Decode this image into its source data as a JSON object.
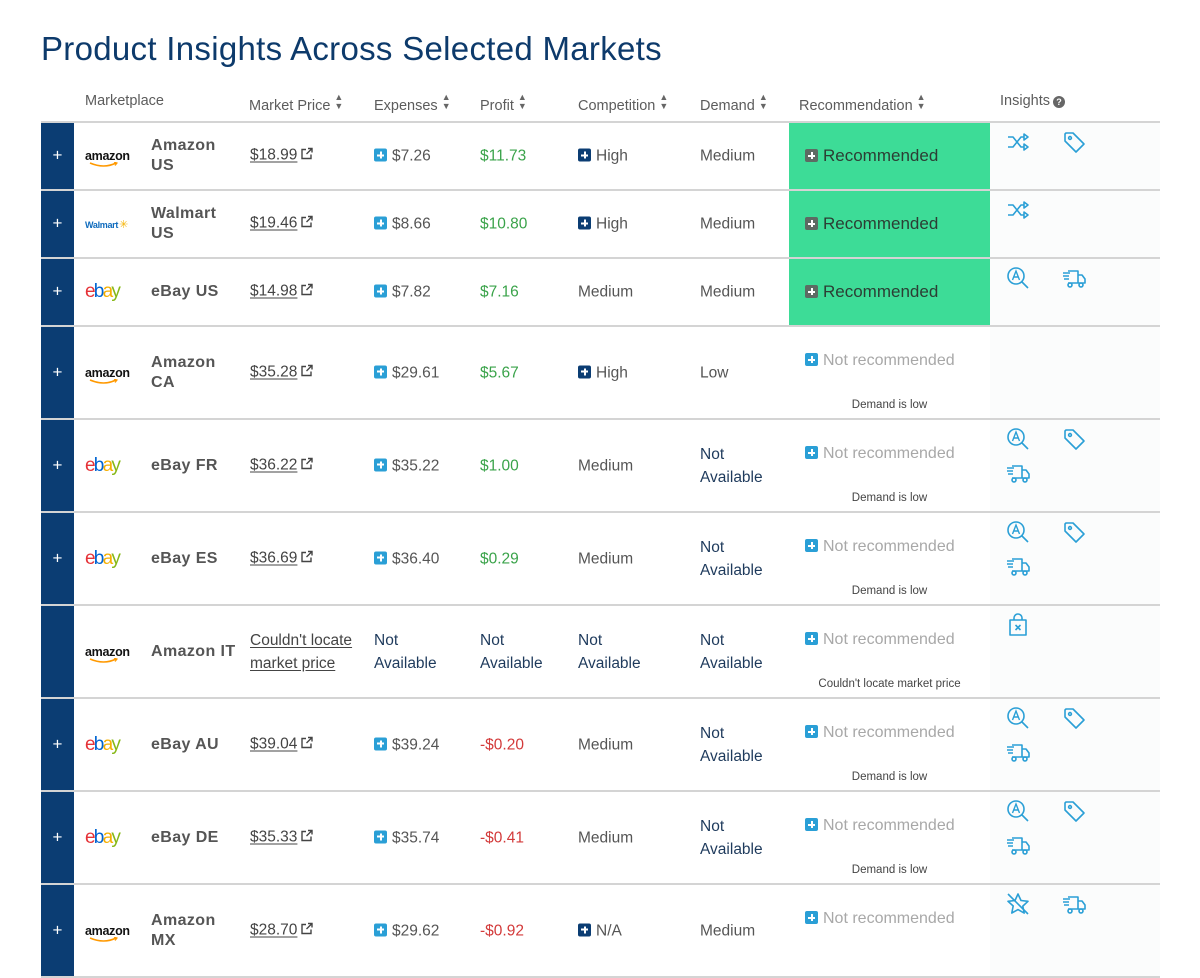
{
  "page": {
    "title": "Product Insights Across Selected Markets"
  },
  "colors": {
    "navy": "#0b3d73",
    "recommended_green": "#3ddc97",
    "profit_positive": "#3aa34a",
    "profit_negative": "#d33a3a",
    "icon_blue": "#2a9fd6"
  },
  "columns": {
    "marketplace": "Marketplace",
    "market_price": "Market Price",
    "expenses": "Expenses",
    "profit": "Profit",
    "competition": "Competition",
    "demand": "Demand",
    "recommendation": "Recommendation",
    "insights": "Insights"
  },
  "rows": [
    {
      "logo": "amazon",
      "name": "Amazon US",
      "price": "$18.99",
      "expenses": "$7.26",
      "profit": "$11.73",
      "profit_sign": "pos",
      "competition": "High",
      "demand": "Medium",
      "recommendation": "Recommended",
      "reason": "",
      "insights": [
        "shuffle-icon",
        "price-tag-icon"
      ]
    },
    {
      "logo": "walmart",
      "name": "Walmart US",
      "price": "$19.46",
      "expenses": "$8.66",
      "profit": "$10.80",
      "profit_sign": "pos",
      "competition": "High",
      "demand": "Medium",
      "recommendation": "Recommended",
      "reason": "",
      "insights": [
        "shuffle-icon"
      ]
    },
    {
      "logo": "ebay",
      "name": "eBay US",
      "price": "$14.98",
      "expenses": "$7.82",
      "profit": "$7.16",
      "profit_sign": "pos",
      "competition": "Medium",
      "demand": "Medium",
      "recommendation": "Recommended",
      "reason": "",
      "insights": [
        "search-text-icon",
        "delivery-truck-icon"
      ]
    },
    {
      "logo": "amazon",
      "name": "Amazon CA",
      "price": "$35.28",
      "expenses": "$29.61",
      "profit": "$5.67",
      "profit_sign": "pos",
      "competition": "High",
      "demand": "Low",
      "recommendation": "Not recommended",
      "reason": "Demand is low",
      "insights": []
    },
    {
      "logo": "ebay",
      "name": "eBay FR",
      "price": "$36.22",
      "expenses": "$35.22",
      "profit": "$1.00",
      "profit_sign": "pos",
      "competition": "Medium",
      "demand": "Not Available",
      "recommendation": "Not recommended",
      "reason": "Demand is low",
      "insights": [
        "search-text-icon",
        "price-tag-icon",
        "delivery-truck-icon"
      ]
    },
    {
      "logo": "ebay",
      "name": "eBay ES",
      "price": "$36.69",
      "expenses": "$36.40",
      "profit": "$0.29",
      "profit_sign": "pos",
      "competition": "Medium",
      "demand": "Not Available",
      "recommendation": "Not recommended",
      "reason": "Demand is low",
      "insights": [
        "search-text-icon",
        "price-tag-icon",
        "delivery-truck-icon"
      ]
    },
    {
      "logo": "amazon",
      "name": "Amazon IT",
      "price": "Couldn't locate market price",
      "expenses": "Not Available",
      "profit": "Not Available",
      "profit_sign": "na",
      "competition": "Not Available",
      "demand": "Not Available",
      "recommendation": "Not recommended",
      "reason": "Couldn't locate market price",
      "insights": [
        "bag-x-icon"
      ]
    },
    {
      "logo": "ebay",
      "name": "eBay AU",
      "price": "$39.04",
      "expenses": "$39.24",
      "profit": "-$0.20",
      "profit_sign": "neg",
      "competition": "Medium",
      "demand": "Not Available",
      "recommendation": "Not recommended",
      "reason": "Demand is low",
      "insights": [
        "search-text-icon",
        "price-tag-icon",
        "delivery-truck-icon"
      ]
    },
    {
      "logo": "ebay",
      "name": "eBay DE",
      "price": "$35.33",
      "expenses": "$35.74",
      "profit": "-$0.41",
      "profit_sign": "neg",
      "competition": "Medium",
      "demand": "Not Available",
      "recommendation": "Not recommended",
      "reason": "Demand is low",
      "insights": [
        "search-text-icon",
        "price-tag-icon",
        "delivery-truck-icon"
      ]
    },
    {
      "logo": "amazon",
      "name": "Amazon MX",
      "price": "$28.70",
      "expenses": "$29.62",
      "profit": "-$0.92",
      "profit_sign": "neg",
      "competition": "N/A",
      "demand": "Medium",
      "recommendation": "Not recommended",
      "reason": "",
      "insights": [
        "star-off-icon",
        "delivery-truck-icon"
      ]
    }
  ],
  "expand_label": "+",
  "logos": {
    "amazon": "amazon",
    "walmart": "Walmart"
  }
}
